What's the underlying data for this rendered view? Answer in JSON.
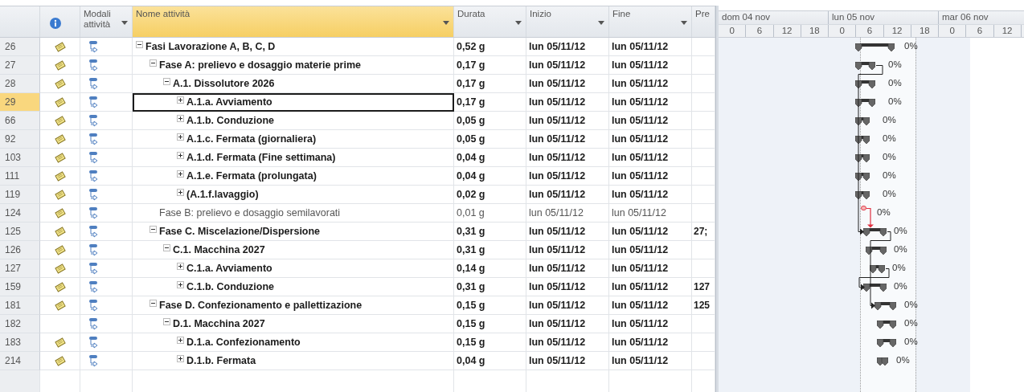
{
  "columns": [
    {
      "kind": "id",
      "selected": false
    },
    {
      "kind": "info",
      "selected": false
    },
    {
      "kind": "text",
      "label": "Modali attività",
      "filter": true,
      "selected": false
    },
    {
      "kind": "text",
      "label": "Nome attività",
      "filter": true,
      "selected": true
    },
    {
      "kind": "text",
      "label": "Durata",
      "filter": true,
      "selected": false
    },
    {
      "kind": "text",
      "label": "Inizio",
      "filter": true,
      "selected": false
    },
    {
      "kind": "text",
      "label": "Fine",
      "filter": true,
      "selected": false
    },
    {
      "kind": "text",
      "label": "Pre",
      "filter": false,
      "selected": false
    }
  ],
  "timescale": {
    "days": [
      {
        "label": "dom 04 nov",
        "hours": [
          "0",
          "6",
          "12",
          "18"
        ]
      },
      {
        "label": "lun 05 nov",
        "hours": [
          "0",
          "6",
          "12",
          "18"
        ]
      },
      {
        "label": "mar 06 nov",
        "hours": [
          "0",
          "6",
          "12"
        ]
      }
    ]
  },
  "tasks": [
    {
      "id": "26",
      "has_note": true,
      "kind": "summary",
      "expanded": true,
      "selected": false,
      "name": "Fasi Lavorazione A, B, C, D",
      "duration": "0,52 g",
      "start": "lun 05/11/12",
      "finish": "lun 05/11/12",
      "progress": "0%",
      "children": [
        {
          "id": "27",
          "has_note": true,
          "kind": "summary",
          "expanded": true,
          "selected": false,
          "name": "Fase A: prelievo e dosaggio materie prime",
          "duration": "0,17 g",
          "start": "lun 05/11/12",
          "finish": "lun 05/11/12",
          "progress": "0%",
          "children": [
            {
              "id": "28",
              "has_note": true,
              "kind": "summary",
              "expanded": true,
              "selected": false,
              "name": "A.1. Dissolutore 2026",
              "duration": "0,17 g",
              "start": "lun 05/11/12",
              "finish": "lun 05/11/12",
              "progress": "0%",
              "children": [
                {
                  "id": "29",
                  "has_note": true,
                  "kind": "summary",
                  "expanded": false,
                  "selected": true,
                  "name": "A.1.a. Avviamento",
                  "duration": "0,17 g",
                  "start": "lun 05/11/12",
                  "finish": "lun 05/11/12",
                  "progress": "0%"
                },
                {
                  "id": "66",
                  "has_note": true,
                  "kind": "summary",
                  "expanded": false,
                  "selected": false,
                  "name": "A.1.b. Conduzione",
                  "duration": "0,05 g",
                  "start": "lun 05/11/12",
                  "finish": "lun 05/11/12",
                  "progress": "0%"
                },
                {
                  "id": "92",
                  "has_note": true,
                  "kind": "summary",
                  "expanded": false,
                  "selected": false,
                  "name": "A.1.c. Fermata (giornaliera)",
                  "duration": "0,05 g",
                  "start": "lun 05/11/12",
                  "finish": "lun 05/11/12",
                  "progress": "0%"
                },
                {
                  "id": "103",
                  "has_note": true,
                  "kind": "summary",
                  "expanded": false,
                  "selected": false,
                  "name": "A.1.d. Fermata (Fine settimana)",
                  "duration": "0,04 g",
                  "start": "lun 05/11/12",
                  "finish": "lun 05/11/12",
                  "progress": "0%"
                },
                {
                  "id": "111",
                  "has_note": true,
                  "kind": "summary",
                  "expanded": false,
                  "selected": false,
                  "name": "A.1.e. Fermata (prolungata)",
                  "duration": "0,04 g",
                  "start": "lun 05/11/12",
                  "finish": "lun 05/11/12",
                  "progress": "0%"
                },
                {
                  "id": "119",
                  "has_note": true,
                  "kind": "summary",
                  "expanded": false,
                  "selected": false,
                  "name": "(A.1.f.lavaggio)",
                  "duration": "0,02 g",
                  "start": "lun 05/11/12",
                  "finish": "lun 05/11/12",
                  "progress": "0%"
                }
              ]
            }
          ]
        },
        {
          "id": "124",
          "has_note": true,
          "kind": "task",
          "selected": false,
          "name": "Fase B: prelievo e dosaggio semilavorati",
          "duration": "0,01 g",
          "start": "lun 05/11/12",
          "finish": "lun 05/11/12",
          "progress": "0%"
        },
        {
          "id": "125",
          "has_note": true,
          "kind": "summary",
          "expanded": true,
          "selected": false,
          "name": "Fase C. Miscelazione/Dispersione",
          "duration": "0,31 g",
          "start": "lun 05/11/12",
          "finish": "lun 05/11/12",
          "predecessors": "27;",
          "progress": "0%",
          "children": [
            {
              "id": "126",
              "has_note": true,
              "kind": "summary",
              "expanded": true,
              "selected": false,
              "name": "C.1. Macchina 2027",
              "duration": "0,31 g",
              "start": "lun 05/11/12",
              "finish": "lun 05/11/12",
              "progress": "0%",
              "children": [
                {
                  "id": "127",
                  "has_note": true,
                  "kind": "summary",
                  "expanded": false,
                  "selected": false,
                  "name": "C.1.a. Avviamento",
                  "duration": "0,14 g",
                  "start": "lun 05/11/12",
                  "finish": "lun 05/11/12",
                  "progress": "0%"
                },
                {
                  "id": "159",
                  "has_note": true,
                  "kind": "summary",
                  "expanded": false,
                  "selected": false,
                  "name": "C.1.b. Conduzione",
                  "duration": "0,31 g",
                  "start": "lun 05/11/12",
                  "finish": "lun 05/11/12",
                  "predecessors": "127",
                  "progress": "0%"
                }
              ]
            }
          ]
        },
        {
          "id": "181",
          "has_note": true,
          "kind": "summary",
          "expanded": true,
          "selected": false,
          "name": "Fase D. Confezionamento e pallettizazione",
          "duration": "0,15 g",
          "start": "lun 05/11/12",
          "finish": "lun 05/11/12",
          "predecessors": "125",
          "progress": "0%",
          "children": [
            {
              "id": "182",
              "has_note": false,
              "kind": "summary",
              "expanded": true,
              "selected": false,
              "name": "D.1. Macchina 2027",
              "duration": "0,15 g",
              "start": "lun 05/11/12",
              "finish": "lun 05/11/12",
              "progress": "0%",
              "children": [
                {
                  "id": "183",
                  "has_note": true,
                  "kind": "summary",
                  "expanded": false,
                  "selected": false,
                  "name": "D.1.a. Confezionamento",
                  "duration": "0,15 g",
                  "start": "lun 05/11/12",
                  "finish": "lun 05/11/12",
                  "progress": "0%"
                },
                {
                  "id": "214",
                  "has_note": true,
                  "kind": "summary",
                  "expanded": false,
                  "selected": false,
                  "name": "D.1.b. Fermata",
                  "duration": "0,04 g",
                  "start": "lun 05/11/12",
                  "finish": "lun 05/11/12",
                  "progress": "0%"
                }
              ]
            }
          ]
        }
      ]
    }
  ]
}
